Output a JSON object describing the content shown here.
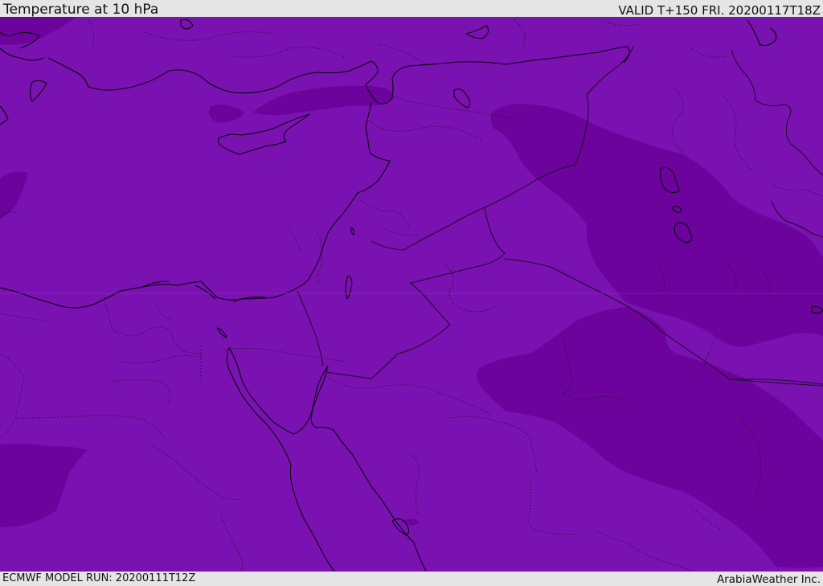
{
  "header": {
    "title": "Temperature at 10 hPa",
    "valid_time": "VALID T+150 FRI. 20200117T18Z"
  },
  "footer": {
    "model_run": "ECMWF MODEL RUN: 20200111T12Z",
    "credit": "ArabiaWeather Inc."
  },
  "map": {
    "colors": {
      "field_base": "#7a12b2",
      "field_cold": "#6b039c",
      "coastline": "#000000",
      "border": "#1a0a22",
      "header_background": "#e5e5e5"
    }
  }
}
